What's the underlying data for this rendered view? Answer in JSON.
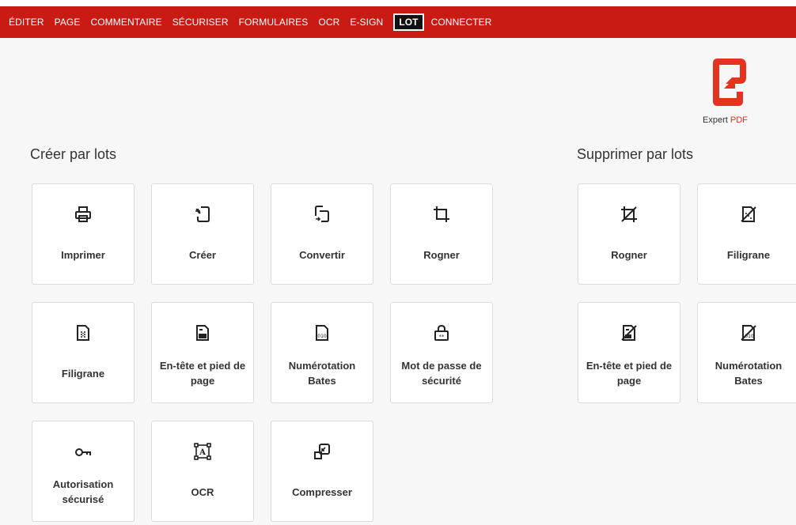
{
  "menu": {
    "items": [
      {
        "label": "ÉDITER"
      },
      {
        "label": "PAGE"
      },
      {
        "label": "COMMENTAIRE"
      },
      {
        "label": "SÉCURISER"
      },
      {
        "label": "FORMULAIRES"
      },
      {
        "label": "OCR"
      },
      {
        "label": "E-SIGN"
      },
      {
        "label": "LOT",
        "active": true
      },
      {
        "label": "CONNECTER"
      }
    ]
  },
  "brand": {
    "name_part1": "Expert",
    "name_part2": "PDF",
    "accent_color": "#e4341f",
    "menu_color": "#c91a14"
  },
  "create_section": {
    "title": "Créer par lots",
    "cards": [
      {
        "label": "Imprimer",
        "icon": "printer-icon"
      },
      {
        "label": "Créer",
        "icon": "create-file-icon"
      },
      {
        "label": "Convertir",
        "icon": "convert-icon"
      },
      {
        "label": "Rogner",
        "icon": "crop-icon"
      },
      {
        "label": "Filigrane",
        "icon": "watermark-icon"
      },
      {
        "label": "En-tête et pied de page",
        "icon": "header-footer-icon"
      },
      {
        "label": "Numérotation Bates",
        "icon": "bates-numbering-icon"
      },
      {
        "label": "Mot de passe de sécurité",
        "icon": "password-lock-icon"
      },
      {
        "label": "Autorisation sécurisé",
        "icon": "key-icon"
      },
      {
        "label": "OCR",
        "icon": "ocr-icon"
      },
      {
        "label": "Compresser",
        "icon": "compress-icon"
      }
    ]
  },
  "remove_section": {
    "title": "Supprimer par lots",
    "cards": [
      {
        "label": "Rogner",
        "icon": "remove-crop-icon"
      },
      {
        "label": "Filigrane",
        "icon": "remove-watermark-icon"
      },
      {
        "label": "En-tête et pied de page",
        "icon": "remove-header-footer-icon"
      },
      {
        "label": "Numérotation Bates",
        "icon": "remove-bates-icon"
      }
    ]
  }
}
